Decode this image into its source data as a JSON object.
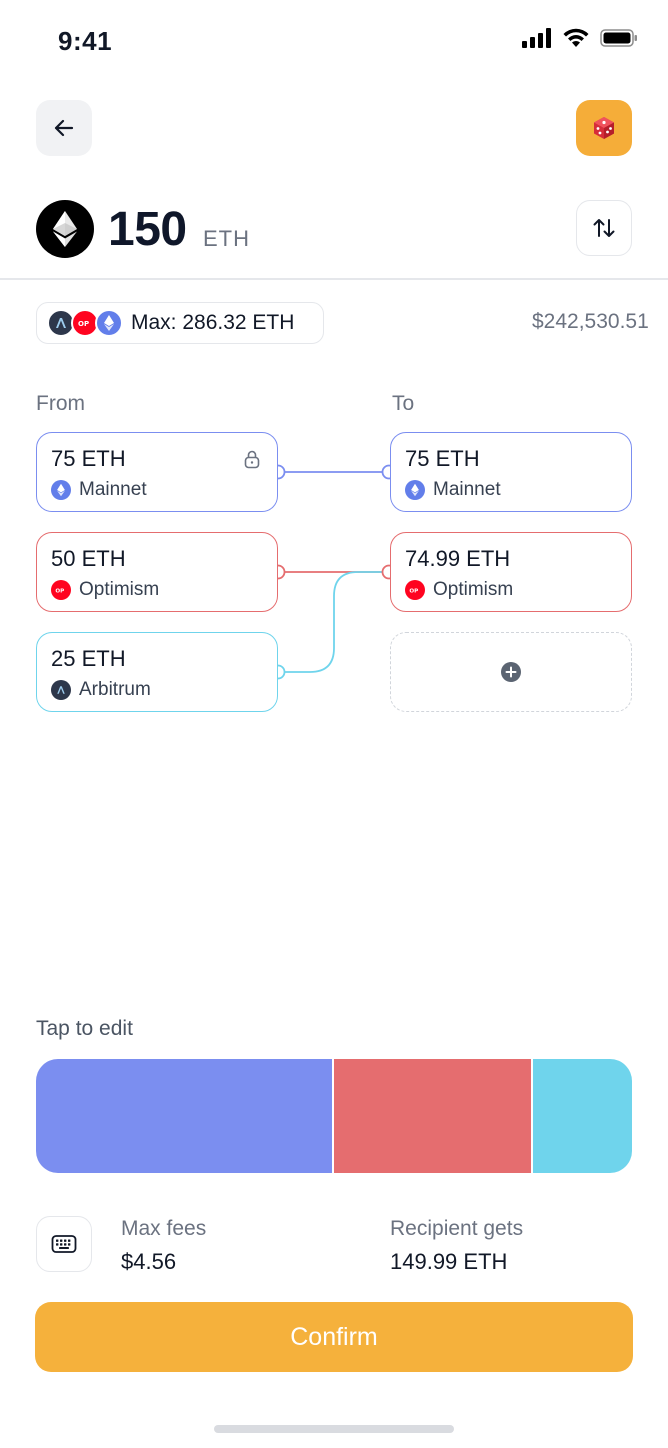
{
  "status_bar": {
    "time": "9:41"
  },
  "amount": {
    "value": "150",
    "unit": "ETH"
  },
  "max_chip": {
    "label": "Max: 286.32 ETH"
  },
  "usd_value": "$242,530.51",
  "from": {
    "label": "From",
    "items": [
      {
        "amount": "75 ETH",
        "network": "Mainnet",
        "color": "#7b8ef0",
        "locked": true
      },
      {
        "amount": "50 ETH",
        "network": "Optimism",
        "color": "#e56d6f",
        "locked": false
      },
      {
        "amount": "25 ETH",
        "network": "Arbitrum",
        "color": "#6fd4ec",
        "locked": false
      }
    ]
  },
  "to": {
    "label": "To",
    "items": [
      {
        "amount": "75 ETH",
        "network": "Mainnet",
        "color": "#7b8ef0"
      },
      {
        "amount": "74.99 ETH",
        "network": "Optimism",
        "color": "#e56d6f"
      }
    ]
  },
  "split": {
    "label": "Tap to edit",
    "segments": [
      {
        "network": "Mainnet",
        "fraction": 0.5,
        "color": "#7b8ef0"
      },
      {
        "network": "Optimism",
        "fraction": 0.333,
        "color": "#e56d6f"
      },
      {
        "network": "Arbitrum",
        "fraction": 0.167,
        "color": "#6fd4ec"
      }
    ]
  },
  "fees": {
    "max_fees_label": "Max fees",
    "max_fees_value": "$4.56",
    "recipient_label": "Recipient gets",
    "recipient_value": "149.99 ETH"
  },
  "confirm_label": "Confirm",
  "icons": {
    "back": "arrow-left-icon",
    "dice": "dice-icon",
    "swap": "swap-vertical-icon",
    "keyboard": "keyboard-icon",
    "add": "plus-circle-icon",
    "lock": "lock-icon"
  },
  "colors": {
    "accent": "#f5b13c",
    "mainnet": "#7b8ef0",
    "optimism": "#e56d6f",
    "arbitrum": "#6fd4ec",
    "optimism_badge": "#ff0420",
    "ethereum_badge": "#627eea",
    "arbitrum_badge": "#2d374b"
  }
}
